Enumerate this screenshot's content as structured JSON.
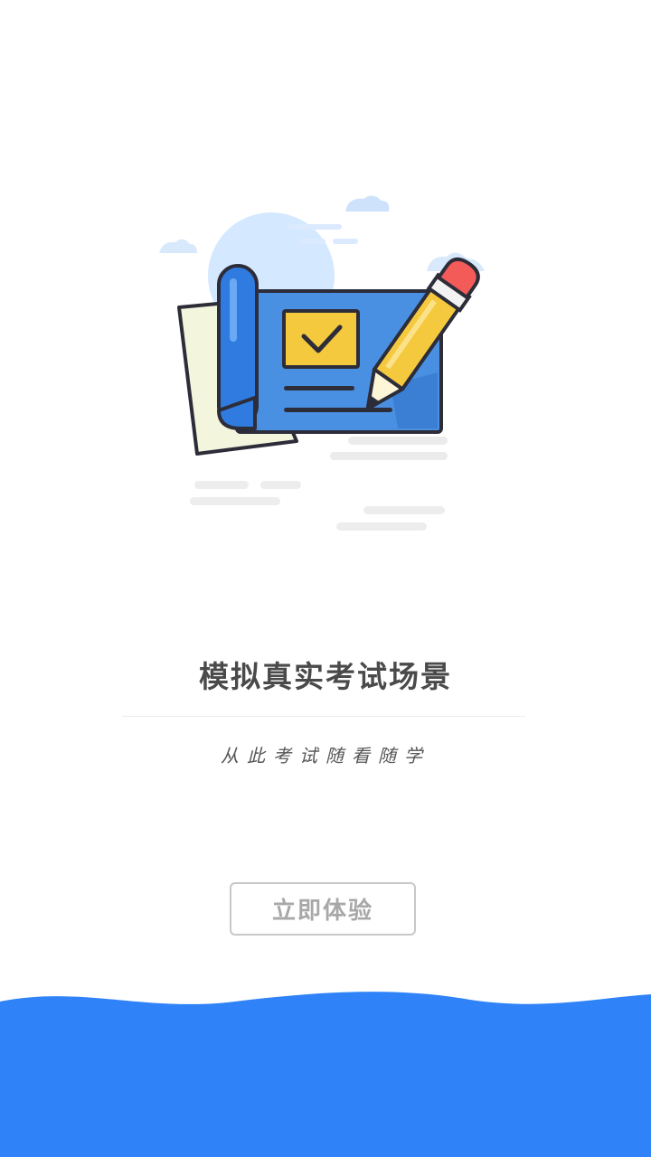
{
  "intro": {
    "title": "模拟真实考试场景",
    "subtitle": "从此考试随看随学",
    "cta_label": "立即体验"
  },
  "colors": {
    "brand_blue": "#2f82f8",
    "paper_blue": "#4a90e2",
    "check_yellow": "#f5c93e",
    "title_text": "#4a4a4a",
    "button_text": "#a8a8a8"
  },
  "icons": {
    "illustration": "exam-paper-with-pencil-illustration"
  }
}
